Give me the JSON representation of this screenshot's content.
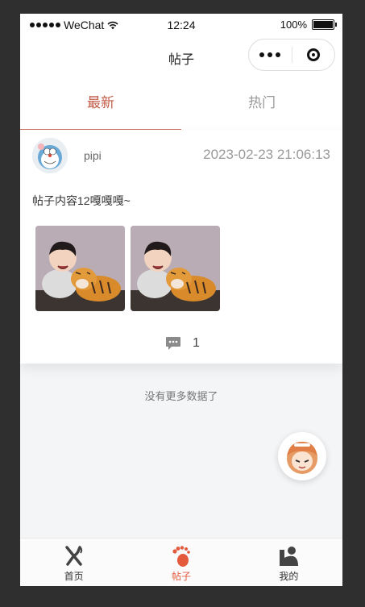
{
  "status_bar": {
    "carrier": "WeChat",
    "time": "12:24",
    "battery": "100%"
  },
  "nav": {
    "title": "帖子"
  },
  "tabs": [
    {
      "label": "最新",
      "active": true
    },
    {
      "label": "热门",
      "active": false
    }
  ],
  "post": {
    "username": "pipi",
    "date": "2023-02-23 21:06:13",
    "content": "帖子内容12嘎嘎嘎~",
    "comment_count": "1"
  },
  "footer_text": "没有更多数据了",
  "tabbar": [
    {
      "label": "首页",
      "icon": "fork-knife-icon"
    },
    {
      "label": "帖子",
      "icon": "footprint-icon",
      "active": true
    },
    {
      "label": "我的",
      "icon": "person-icon"
    }
  ],
  "colors": {
    "accent": "#c25b46",
    "tabbar_active": "#e35a3c"
  }
}
